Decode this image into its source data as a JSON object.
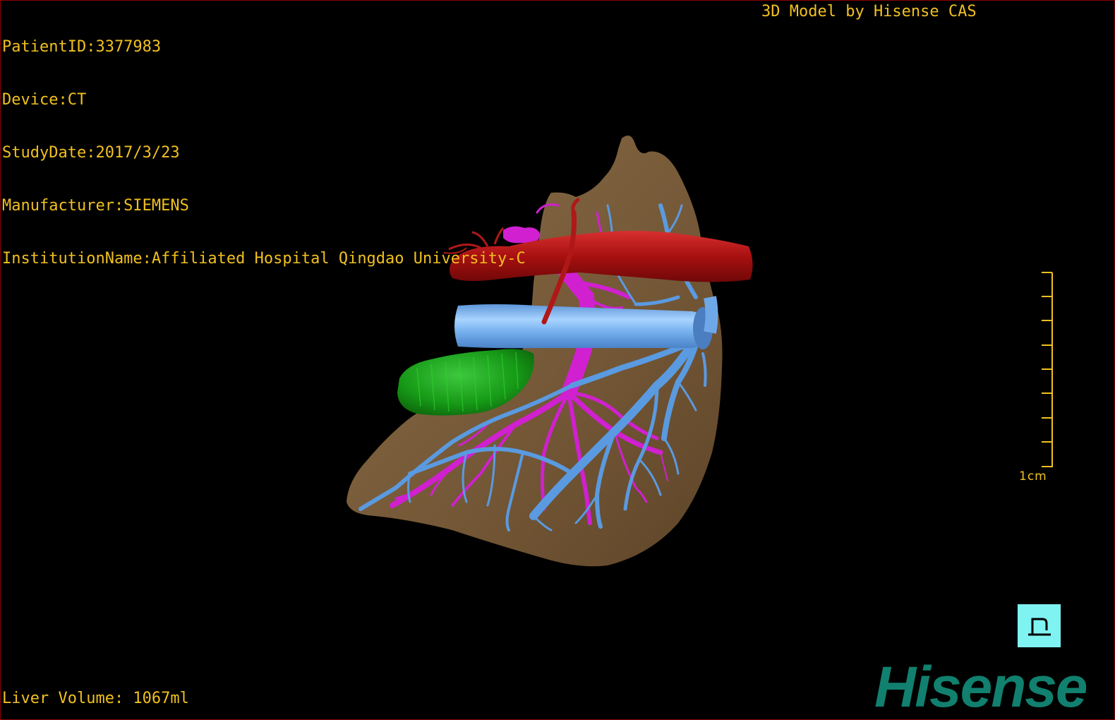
{
  "patient_info": {
    "patient_id": "PatientID:3377983",
    "device": "Device:CT",
    "study_date": "StudyDate:2017/3/23",
    "manufacturer": "Manufacturer:SIEMENS",
    "institution": "InstitutionName:Affiliated Hospital Qingdao University-C"
  },
  "credit": "3D Model by Hisense CAS",
  "liver_volume": "Liver Volume: 1067ml",
  "scale": {
    "label": "1cm"
  },
  "brand": "Hisense",
  "orientation_button": {
    "icon": "posterior-orientation-icon",
    "glyph": "P"
  },
  "colors": {
    "overlay_text": "#f0c020",
    "liver": "#7a5e3c",
    "artery": "#b01818",
    "vena_cava": "#6fa8e8",
    "portal_vein": "#d020d0",
    "hepatic_vein": "#5a9ae0",
    "tumor": "#18a018",
    "brand": "#11806e",
    "border": "#8b0000"
  }
}
